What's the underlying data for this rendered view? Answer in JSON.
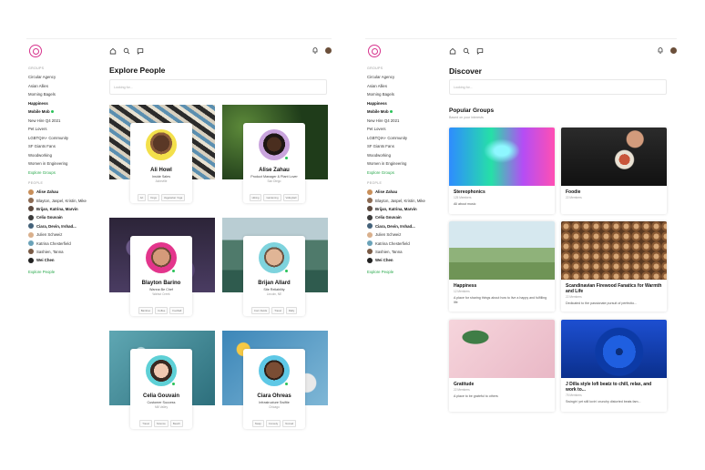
{
  "colors": {
    "accent": "#d6338d",
    "green": "#27a84a",
    "online": "#2bc259"
  },
  "left": {
    "groups_title": "GROUPS",
    "groups": [
      "Circular Agency",
      "Asian Allies",
      "Morning Bagels",
      "Happiness",
      "Mobile Mob",
      "New Hire Q4 2021",
      "Pet Lovers",
      "LGBTQIA+ Community",
      "SF Giants Fans",
      "Woodworking",
      "Women in Engineering"
    ],
    "explore_groups": "Explore Groups",
    "people_title": "PEOPLE",
    "people": [
      "Alise Zahau",
      "Blayton, Jaspel, Kristin, Mike",
      "Brijan, Katrina, Marvin",
      "Celia Gouvain",
      "Ciara, Devin, Irshad...",
      "Julien Schweiz",
      "Katrina Chesterfield",
      "Sashien, Tanna",
      "Wei Chen"
    ],
    "explore_people": "Explore People",
    "title": "Explore People",
    "search_placeholder": "Looking for...",
    "cards": [
      {
        "name": "Ali Howl",
        "role": "Inside Sales",
        "location": "Asheville",
        "tags": [
          "Art",
          "Dogs",
          "Vegetarian Yoga"
        ]
      },
      {
        "name": "Alise Zahau",
        "role": "Product Manager & Plant Lover",
        "location": "San Diego",
        "tags": [
          "Hiking",
          "Gardening",
          "Volleyball"
        ]
      },
      {
        "name": "Blayton Barino",
        "role": "Wanna Be Chef",
        "location": "Walnut Creek",
        "tags": [
          "Bamboo",
          "Coffee",
          "Football"
        ]
      },
      {
        "name": "Brijan Allard",
        "role": "Site Reliability",
        "location": "Lincoln, NE",
        "tags": [
          "Corn Fields",
          "Travel",
          "Rally"
        ]
      },
      {
        "name": "Celia Gouvain",
        "role": "Customer Success",
        "location": "Mill Valley",
        "tags": [
          "Travel",
          "Science",
          "Beach"
        ]
      },
      {
        "name": "Ciara Ohreas",
        "role": "Infrastructure Swiftie",
        "location": "Chicago",
        "tags": [
          "Swap",
          "Comedy",
          "Nomad"
        ]
      }
    ]
  },
  "right": {
    "groups_title": "GROUPS",
    "groups": [
      "Circular Agency",
      "Asian Allies",
      "Morning Bagels",
      "Happiness",
      "Mobile Mob",
      "New Hire Q4 2021",
      "Pet Lovers",
      "LGBTQIA+ Community",
      "SF Giants Fans",
      "Woodworking",
      "Women in Engineering"
    ],
    "explore_groups": "Explore Groups",
    "people_title": "PEOPLE",
    "people": [
      "Alise Zahau",
      "Blayton, Jaspel, Kristin, Mike",
      "Brijan, Katrina, Marvin",
      "Celia Gouvain",
      "Ciara, Devin, Irshad...",
      "Julien Schweiz",
      "Katrina Chesterfield",
      "Sashien, Tanna",
      "Wei Chen"
    ],
    "explore_people": "Explore People",
    "title": "Discover",
    "search_placeholder": "Looking for...",
    "popular_title": "Popular Groups",
    "popular_sub": "Based on your interests",
    "groups_cards": [
      {
        "title": "Stereophonics",
        "members": "125 Members",
        "desc": "All about music"
      },
      {
        "title": "Foodie",
        "members": "22 Members",
        "desc": ""
      },
      {
        "title": "Happiness",
        "members": "12 Members",
        "desc": "A place for sharing things about how to live a happy and fulfilling life"
      },
      {
        "title": "Scandinavian Firewood Fanatics for Warmth and Life",
        "members": "22 Members",
        "desc": "Dedicated to the passionate pursuit of perfectio..."
      },
      {
        "title": "Gratitude",
        "members": "22 Members",
        "desc": "A place to be grateful to others"
      },
      {
        "title": "J Dilla style lofi beatz to chill, relax, and work to...",
        "members": "75 Members",
        "desc": "Swingin' yet still lovin' crunchy distorted beats fam..."
      }
    ]
  }
}
